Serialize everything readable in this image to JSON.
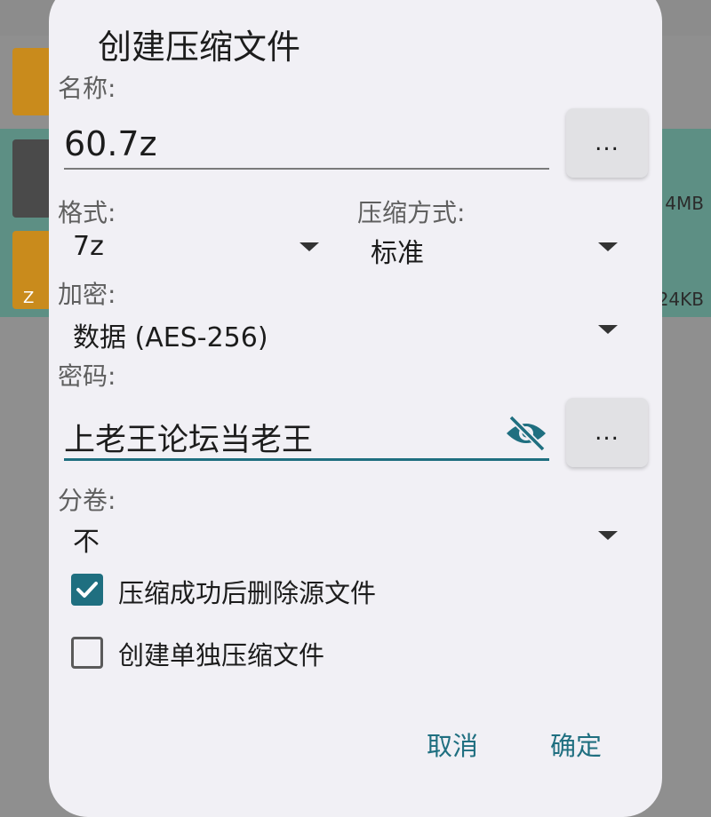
{
  "background": {
    "rows": [
      {
        "size": "4MB"
      },
      {
        "size": "24KB"
      }
    ],
    "archive_letter": "Z"
  },
  "dialog": {
    "title": "创建压缩文件",
    "name": {
      "label": "名称:",
      "value": "60.7z",
      "browse": "..."
    },
    "format": {
      "label": "格式:",
      "value": "7z"
    },
    "method": {
      "label": "压缩方式:",
      "value": "标准"
    },
    "encryption": {
      "label": "加密:",
      "value": "数据 (AES-256)"
    },
    "password": {
      "label": "密码:",
      "value": "上老王论坛当老王",
      "browse": "..."
    },
    "split": {
      "label": "分卷:",
      "value": "不"
    },
    "options": [
      {
        "label": "压缩成功后删除源文件",
        "checked": true
      },
      {
        "label": "创建单独压缩文件",
        "checked": false
      }
    ],
    "actions": {
      "cancel": "取消",
      "ok": "确定"
    }
  },
  "colors": {
    "accent": "#1f6f80",
    "dialog_bg": "#f1f0f5"
  }
}
